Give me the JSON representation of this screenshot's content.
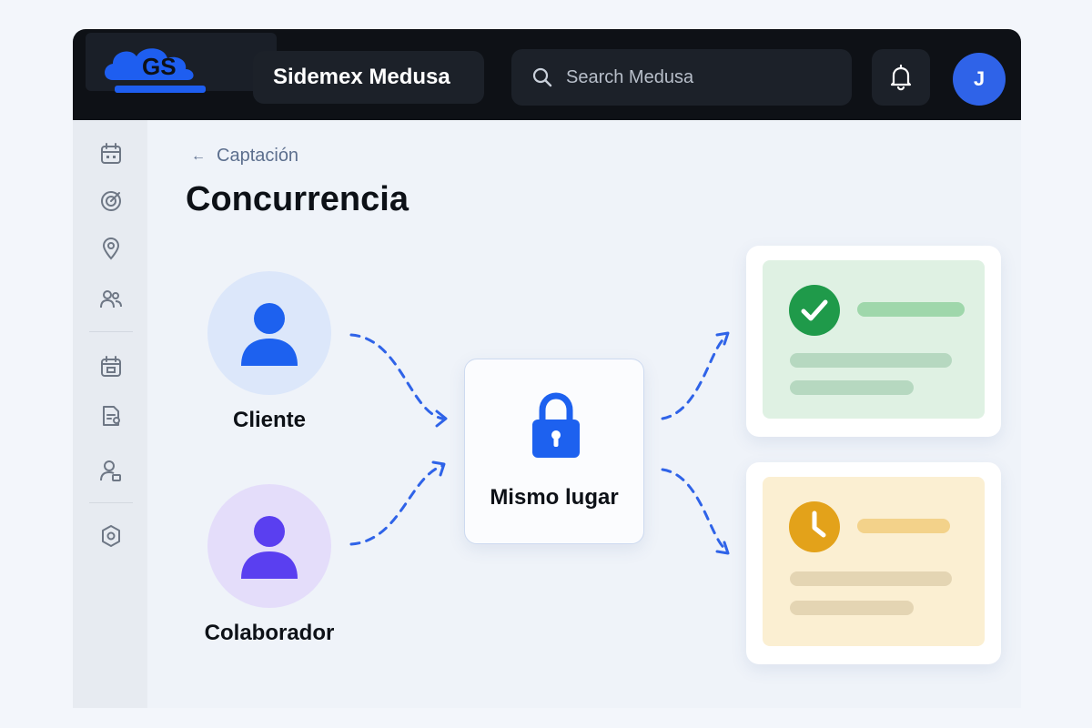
{
  "header": {
    "app_name": "Sidemex Medusa",
    "search_placeholder": "Search Medusa",
    "avatar_initial": "J"
  },
  "breadcrumb": {
    "label": "Captación"
  },
  "page": {
    "title": "Concurrencia"
  },
  "diagram": {
    "client_label": "Cliente",
    "collaborator_label": "Colaborador",
    "center_label": "Mismo lugar"
  },
  "colors": {
    "accent": "#2f63e8",
    "success": "#1f9a4a",
    "pending": "#e3a21a"
  },
  "icons": {
    "sidebar": [
      "calendar-icon",
      "target-icon",
      "location-pin-icon",
      "users-icon",
      "calendar-check-icon",
      "document-icon",
      "user-settings-icon",
      "shield-icon"
    ]
  }
}
